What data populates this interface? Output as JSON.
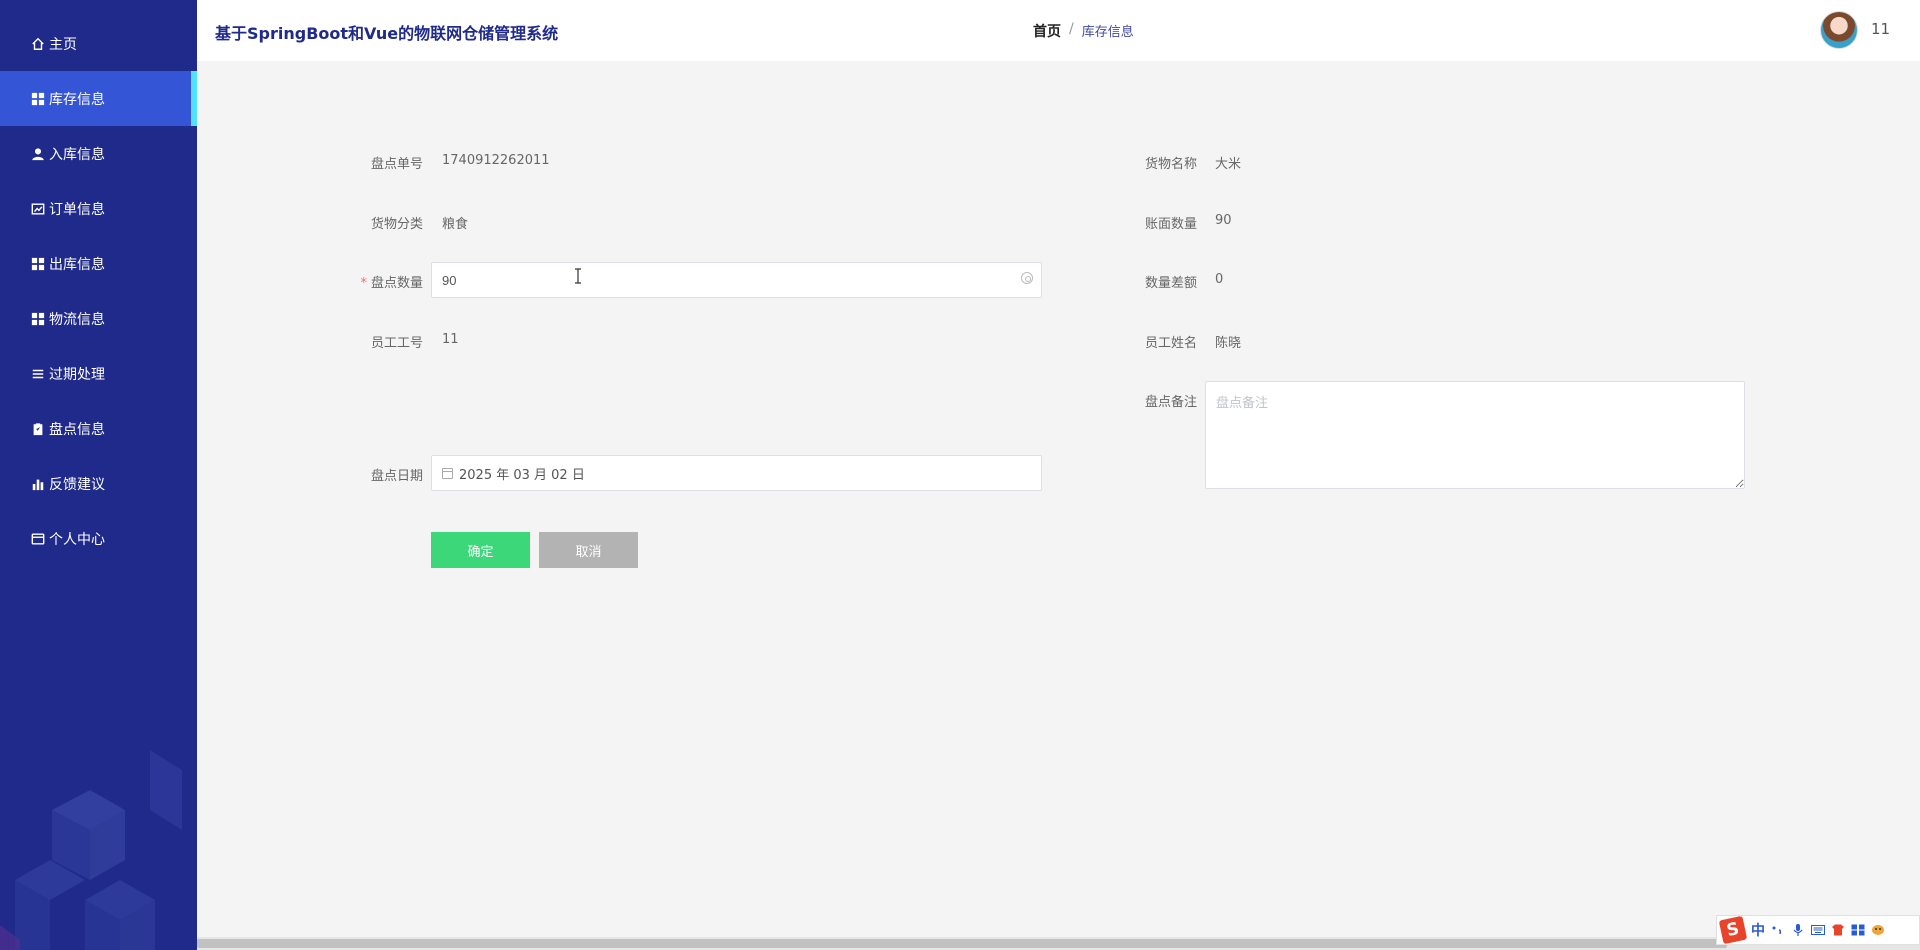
{
  "sidebar": {
    "items": [
      {
        "label": "主页",
        "icon": "home-icon"
      },
      {
        "label": "库存信息",
        "icon": "grid-icon",
        "active": true
      },
      {
        "label": "入库信息",
        "icon": "user-icon"
      },
      {
        "label": "订单信息",
        "icon": "chart-icon"
      },
      {
        "label": "出库信息",
        "icon": "grid-icon"
      },
      {
        "label": "物流信息",
        "icon": "grid-icon"
      },
      {
        "label": "过期处理",
        "icon": "list-icon"
      },
      {
        "label": "盘点信息",
        "icon": "clipboard-icon"
      },
      {
        "label": "反馈建议",
        "icon": "bar-chart-icon"
      },
      {
        "label": "个人中心",
        "icon": "card-icon"
      }
    ]
  },
  "header": {
    "title": "基于SpringBoot和Vue的物联网仓储管理系统",
    "breadcrumb_home": "首页",
    "breadcrumb_sep": "/",
    "breadcrumb_current": "库存信息",
    "username": "11"
  },
  "form": {
    "check_no_label": "盘点单号",
    "check_no_value": "1740912262011",
    "goods_name_label": "货物名称",
    "goods_name_value": "大米",
    "category_label": "货物分类",
    "category_value": "粮食",
    "book_qty_label": "账面数量",
    "book_qty_value": "90",
    "check_qty_label": "盘点数量",
    "check_qty_required": "*",
    "check_qty_value": "90",
    "diff_label": "数量差额",
    "diff_value": "0",
    "emp_no_label": "员工工号",
    "emp_no_value": "11",
    "emp_name_label": "员工姓名",
    "emp_name_value": "陈晓",
    "remark_label": "盘点备注",
    "remark_placeholder": "盘点备注",
    "date_label": "盘点日期",
    "date_value": "2025 年 03 月 02 日",
    "ok_label": "确定",
    "cancel_label": "取消"
  },
  "ime": {
    "logo": "S",
    "mode": "中"
  },
  "colors": {
    "sidebar_bg": "#1f2a8a",
    "sidebar_active": "#3355d6",
    "active_marker": "#4fe3ff",
    "ok_button": "#3cd779",
    "cancel_button": "#b3b3b3"
  }
}
